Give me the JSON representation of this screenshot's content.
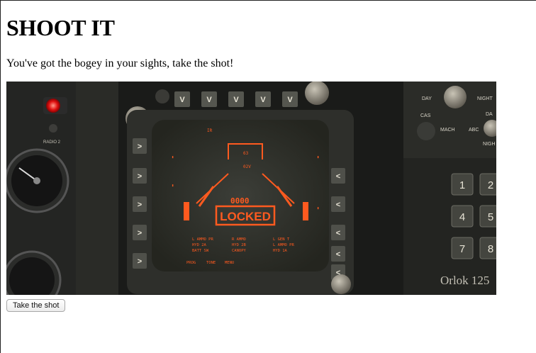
{
  "page": {
    "title": "SHOOT IT",
    "subtitle": "You've got the bogey in your sights, take the shot!",
    "button_label": "Take the shot"
  },
  "cockpit": {
    "top_keys": [
      "V",
      "V",
      "V",
      "V",
      "V"
    ],
    "left_keys": [
      ">",
      ">",
      ">",
      ">",
      ">"
    ],
    "right_keys": [
      "<",
      "<",
      "<",
      "<",
      "<"
    ],
    "panel_labels": {
      "radio": "RADIO 2",
      "day": "DAY",
      "night": "NIGHT",
      "cas": "CAS",
      "mach": "MACH",
      "abc": "ABC",
      "nigh": "NIGH",
      "da": "DA"
    },
    "keypad": [
      "1",
      "2",
      "4",
      "5",
      "7",
      "8"
    ],
    "watermark": "Orlok 125",
    "colors": {
      "screen_text": "#ff5a1f",
      "screen_bg": "#33352f",
      "panel": "#1c1d1b"
    }
  },
  "screen": {
    "top_mark": "IR",
    "center_box_top": "63",
    "center_box_bottom": "02V",
    "range_marks": "0000",
    "lock_label": "LOCKED",
    "status_lines": [
      [
        "L AMMO PR",
        "HYD 2A",
        "BATT SW"
      ],
      [
        "R AMMO",
        "HYD 2B",
        "CANOPY"
      ],
      [
        "L GEN T",
        "L AMMO PR",
        "HYD 1A"
      ]
    ],
    "footer": [
      "PROG",
      "TONE",
      "MENU"
    ]
  }
}
